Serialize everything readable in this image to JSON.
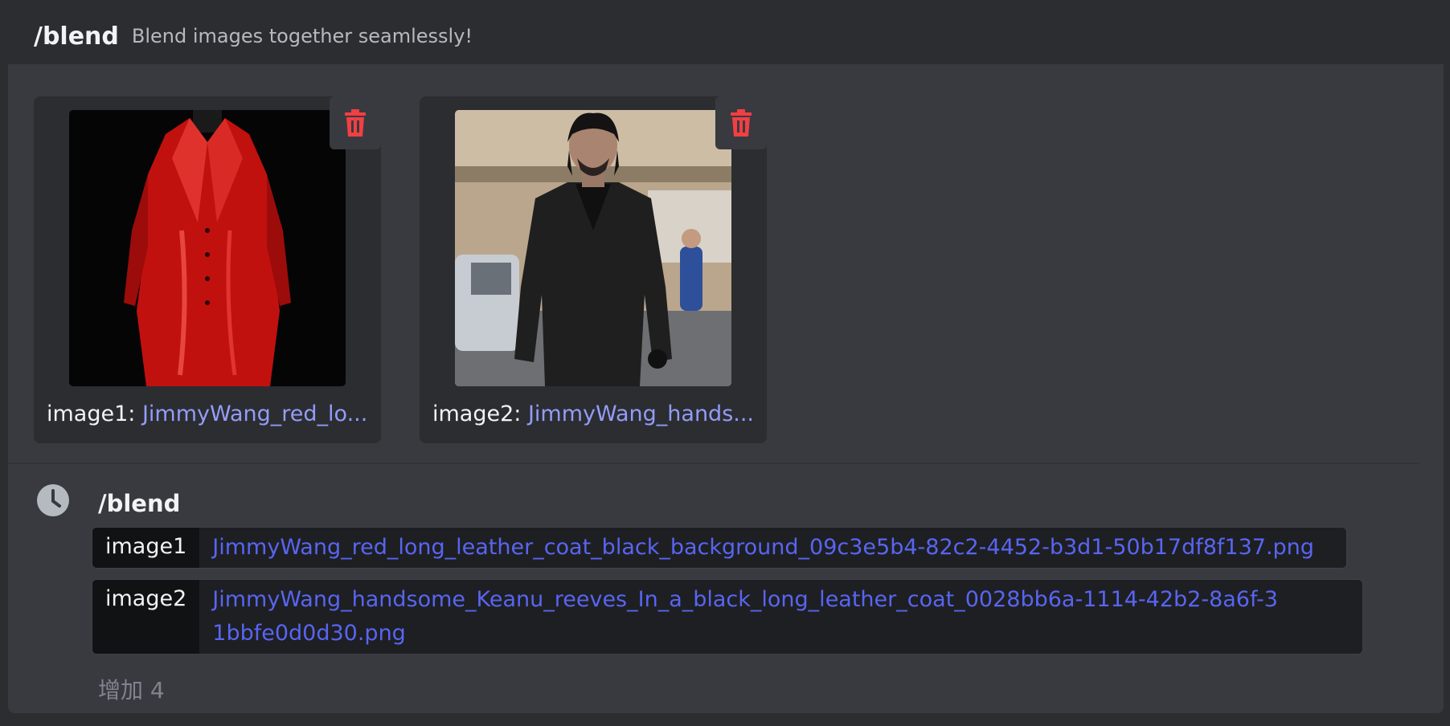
{
  "header": {
    "command": "/blend",
    "description": "Blend images together seamlessly!"
  },
  "attachments": [
    {
      "label": "image1:",
      "filename": "JimmyWang_red_lo..."
    },
    {
      "label": "image2:",
      "filename": "JimmyWang_hands..."
    }
  ],
  "pending": {
    "command": "/blend",
    "options": [
      {
        "key": "image1",
        "value": "JimmyWang_red_long_leather_coat_black_background_09c3e5b4-82c2-4452-b3d1-50b17df8f137.png"
      },
      {
        "key": "image2",
        "value": "JimmyWang_handsome_Keanu_reeves_In_a_black_long_leather_coat_0028bb6a-1114-42b2-8a6f-31bbfe0d0d30.png"
      }
    ],
    "more": "增加 4"
  },
  "colors": {
    "accent": "#5865f2",
    "link": "#949cf7",
    "danger": "#f23f43"
  },
  "icons": [
    "trash-icon",
    "clock-icon"
  ]
}
